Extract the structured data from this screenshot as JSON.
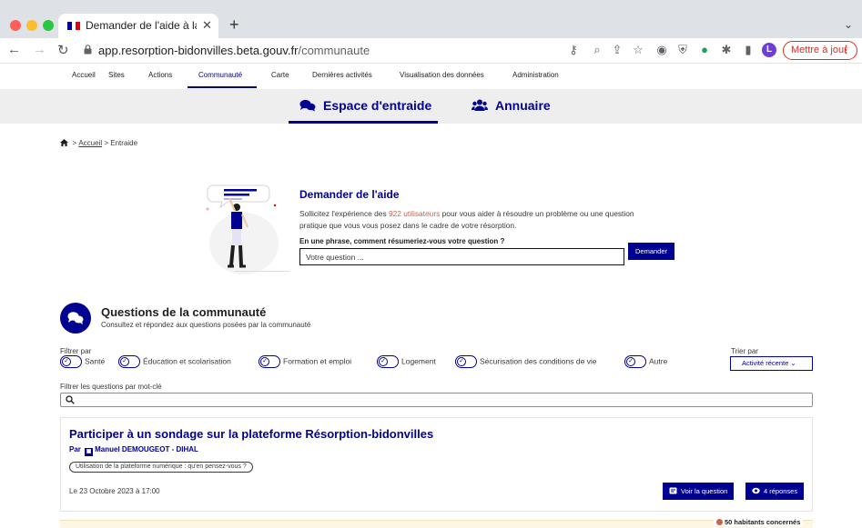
{
  "browser": {
    "tab_title": "Demander de l'aide à la comm",
    "url_host": "app.resorption-bidonvilles.beta.gouv.fr",
    "url_path": "/communaute",
    "avatar_letter": "L",
    "update_label": "Mettre à jour"
  },
  "sitenav": {
    "items": [
      "Accueil",
      "Sites",
      "Actions",
      "Communauté",
      "Carte",
      "Dernières activités",
      "Visualisation des données",
      "Administration"
    ],
    "active": "Communauté"
  },
  "subnav": {
    "tab1": "Espace d'entraide",
    "tab2": "Annuaire"
  },
  "breadcrumb": {
    "home": "Accueil",
    "current": "Entraide"
  },
  "ask": {
    "title": "Demander de l'aide",
    "text_before": "Sollicitez l'expérience des ",
    "users_link": "922 utilisateurs",
    "text_after": " pour vous aider à résoudre un problème ou une question pratique que vous vous posez dans le cadre de votre résorption.",
    "label": "En une phrase, comment résumeriez-vous votre question ?",
    "placeholder": "Votre question ...",
    "button": "Demander"
  },
  "community": {
    "title": "Questions de la communauté",
    "subtitle": "Consultez et répondez aux questions posées par la communauté",
    "filter_label": "Filtrer par",
    "filters": [
      "Santé",
      "Éducation et scolarisation",
      "Formation et emploi",
      "Logement",
      "Sécurisation des conditions de vie",
      "Autre"
    ],
    "sort_label": "Trier par",
    "sort_value": "Activité récente",
    "keyword_label": "Filtrer les questions par mot-clé"
  },
  "question": {
    "title": "Participer à un sondage sur la plateforme Résorption-bidonvilles",
    "author_prefix": "Par",
    "author": "Manuel DEMOUGEOT - DIHAL",
    "tag": "Utilisation de la plateforme numérique : qu'en pensez-vous ?",
    "date": "Le 23 Octobre 2023 à 17:00",
    "view_button": "Voir la question",
    "answers_button": "4 réponses"
  },
  "next_card": {
    "habitants": "50 habitants concernés"
  }
}
